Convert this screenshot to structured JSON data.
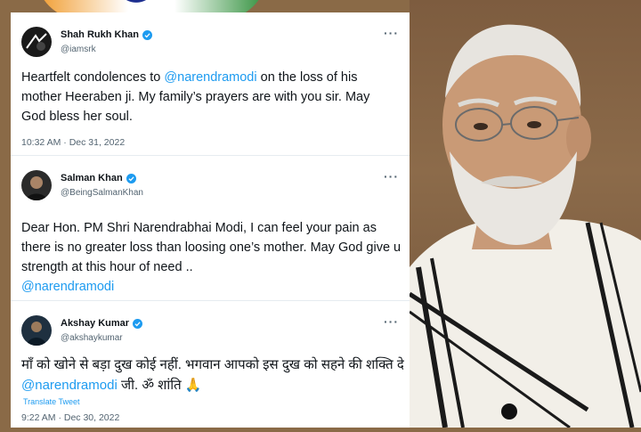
{
  "tweets": [
    {
      "name": "Shah Rukh Khan",
      "handle": "@iamsrk",
      "text_before": "Heartfelt condolences to ",
      "mention": "@narendramodi",
      "text_after": " on the loss of his mother Heeraben ji. My family’s prayers are with you sir. May God bless her soul.",
      "time": "10:32 AM · Dec 31, 2022"
    },
    {
      "name": "Salman Khan",
      "handle": "@BeingSalmanKhan",
      "text_before": "Dear Hon. PM Shri Narendrabhai Modi, I can feel your pain as there is no greater loss than loosing one’s mother. May God give u strength at this hour of need ..",
      "mention": "@narendramodi",
      "text_after": ""
    },
    {
      "name": "Akshay Kumar",
      "handle": "@akshaykumar",
      "text_before": "माँ को खोने से बड़ा दुख कोई नहीं. भगवान आपको इस दुख को सहने की शक्ति दे ",
      "mention": "@narendramodi",
      "text_after": " जी. ॐ शांति 🙏",
      "translate": "Translate Tweet",
      "time": "9:22 AM · Dec 30, 2022"
    }
  ],
  "more_label": "···",
  "colors": {
    "link": "#1d9bf0",
    "verified": "#1d9bf0"
  }
}
